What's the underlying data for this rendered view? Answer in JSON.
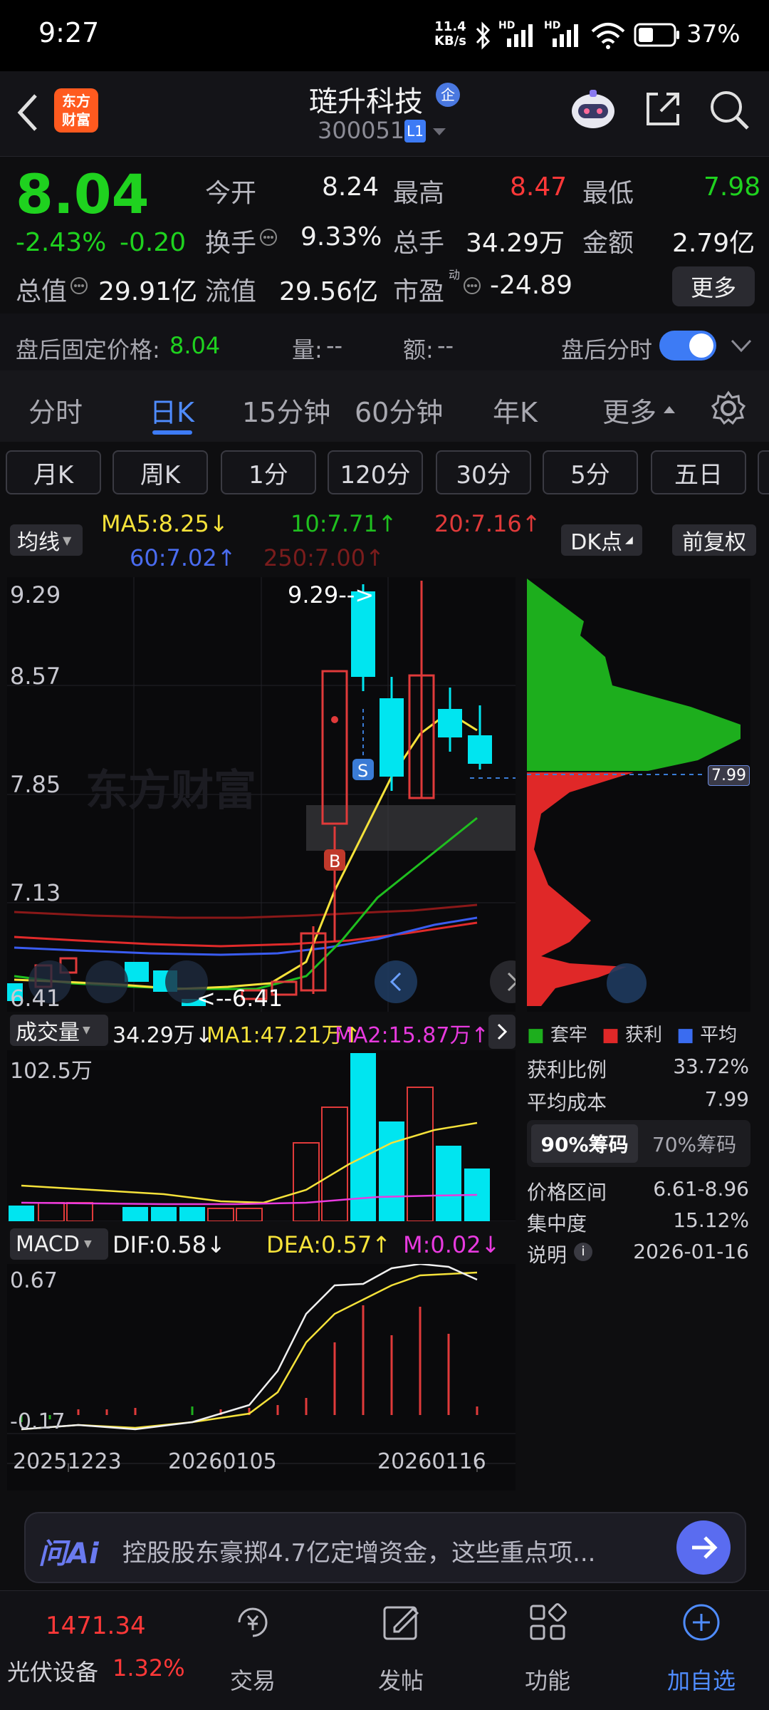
{
  "status": {
    "time": "9:27",
    "net_speed_top": "11.4",
    "net_speed_bottom": "KB/s",
    "battery": "37%",
    "hd1": "HD",
    "hd2": "HD"
  },
  "nav": {
    "logo_line1": "东方",
    "logo_line2": "财富",
    "title": "琏升科技",
    "title_badge": "企",
    "code": "300051",
    "code_badge": "L1"
  },
  "quote": {
    "price": "8.04",
    "change_pct": "-2.43%",
    "change": "-0.20",
    "open_label": "今开",
    "open": "8.24",
    "high_label": "最高",
    "high": "8.47",
    "low_label": "最低",
    "low": "7.98",
    "turnover_label": "换手",
    "turnover": "9.33%",
    "vol_label": "总手",
    "vol": "34.29万",
    "amt_label": "金额",
    "amt": "2.79亿",
    "cap_label": "总值",
    "cap": "29.91亿",
    "float_label": "流值",
    "float": "29.56亿",
    "pe_label": "市盈",
    "pe_sup": "动",
    "pe": "-24.89",
    "more": "更多",
    "after_label": "盘后固定价格:",
    "after_price": "8.04",
    "after_vol_label": "量:",
    "after_vol": "--",
    "after_amt_label": "额:",
    "after_amt": "--",
    "after_toggle_label": "盘后分时"
  },
  "tabs": [
    "分时",
    "日K",
    "15分钟",
    "60分钟",
    "年K",
    "更多"
  ],
  "pills": [
    "月K",
    "周K",
    "1分",
    "120分",
    "30分",
    "5分",
    "五日"
  ],
  "ma": {
    "selector": "均线",
    "ma5": "MA5:8.25",
    "ma10": "10:7.71",
    "ma20": "20:7.16",
    "ma60": "60:7.02",
    "ma250": "250:7.00",
    "dk": "DK点",
    "fq": "前复权"
  },
  "kchart": {
    "y_labels": [
      "9.29",
      "8.57",
      "7.85",
      "7.13",
      "6.41"
    ],
    "max_label": "9.29-->",
    "min_label": "<--6.41",
    "watermark": "东方财富",
    "sell": "S",
    "buy": "B",
    "cost_tag": "7.99"
  },
  "vol": {
    "selector": "成交量",
    "value": "34.29万",
    "ma1": "MA1:47.21万",
    "ma2": "MA2:15.87万",
    "y_label": "102.5万"
  },
  "macd": {
    "selector": "MACD",
    "dif": "DIF:0.58",
    "dea": "DEA:0.57",
    "m": "M:0.02",
    "y_top": "0.67",
    "y_bottom": "-0.17",
    "dates": [
      "20251223",
      "20260105",
      "20260116"
    ]
  },
  "chip": {
    "legend": [
      "套牢",
      "获利",
      "平均"
    ],
    "profit_label": "获利比例",
    "profit": "33.72%",
    "avg_label": "平均成本",
    "avg": "7.99",
    "tab90": "90%筹码",
    "tab70": "70%筹码",
    "range_label": "价格区间",
    "range": "6.61-8.96",
    "conc_label": "集中度",
    "conc": "15.12%",
    "note_label": "说明",
    "note": "2026-01-16"
  },
  "ai": {
    "logo": "问Ai",
    "text": "控股股东豪掷4.7亿定增资金，这些重点项..."
  },
  "bottom": {
    "index_value": "1471.34",
    "index_name": "光伏设备",
    "index_pct": "1.32%",
    "items": [
      "交易",
      "发帖",
      "功能",
      "加自选"
    ]
  },
  "colors": {
    "up": "#ff3838",
    "down": "#1fd21f",
    "cyan": "#00e5f0",
    "accent": "#3d7bf5"
  }
}
